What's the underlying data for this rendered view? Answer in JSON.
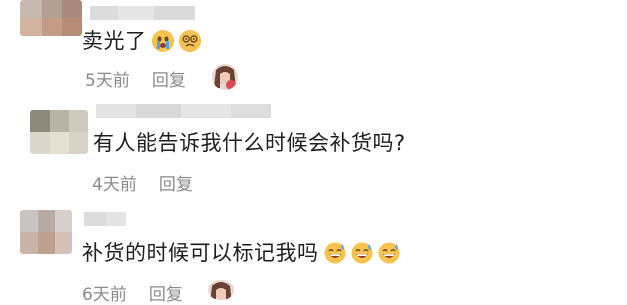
{
  "comments": [
    {
      "text": "卖光了",
      "time": "5天前",
      "reply": "回复",
      "emojis": [
        "crying-face-icon",
        "dizzy-face-icon"
      ]
    },
    {
      "text": "有人能告诉我什么时候会补货吗?",
      "time": "4天前",
      "reply": "回复",
      "emojis": []
    },
    {
      "text": "补货的时候可以标记我吗",
      "time": "6天前",
      "reply": "回复",
      "emojis": [
        "grinning-sweat-icon",
        "grinning-sweat-icon",
        "grinning-sweat-icon"
      ]
    }
  ]
}
